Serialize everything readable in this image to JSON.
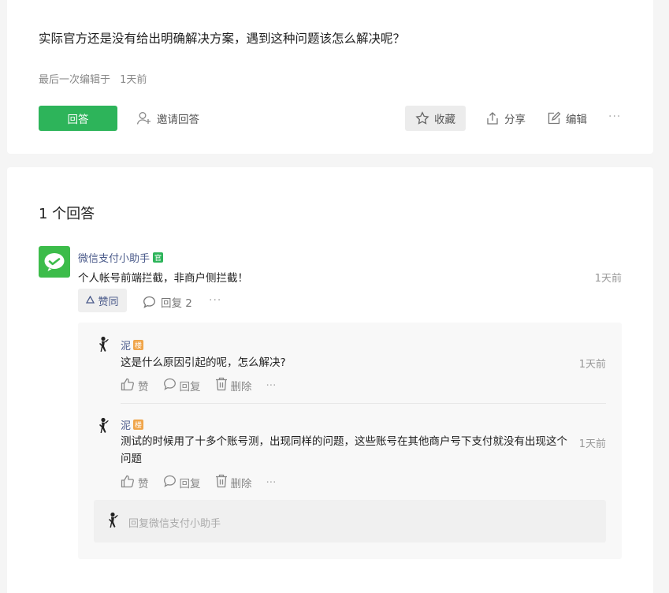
{
  "question": {
    "text": "实际官方还是没有给出明确解决方案，遇到这种问题该怎么解决呢？",
    "meta_label": "最后一次编辑于",
    "meta_time": "1天前",
    "actions": {
      "answer": "回答",
      "invite": "邀请回答",
      "favorite": "收藏",
      "share": "分享",
      "edit": "编辑",
      "more": "···"
    }
  },
  "answers": {
    "count_label": "1 个回答",
    "items": [
      {
        "author": "微信支付小助手",
        "badge": "官",
        "text": "个人帐号前端拦截，非商户侧拦截！",
        "time": "1天前",
        "like_label": "赞同",
        "reply_label": "回复 2",
        "more": "···",
        "comments": [
          {
            "author": "泥",
            "badge": "楼",
            "text": "这是什么原因引起的呢，怎么解决?",
            "time": "1天前",
            "actions": {
              "like": "赞",
              "reply": "回复",
              "delete": "删除",
              "more": "···"
            }
          },
          {
            "author": "泥",
            "badge": "楼",
            "text": "测试的时候用了十多个账号测，出现同样的问题，这些账号在其他商户号下支付就没有出现这个问题",
            "time": "1天前",
            "actions": {
              "like": "赞",
              "reply": "回复",
              "delete": "删除",
              "more": "···"
            }
          }
        ],
        "reply_placeholder": "回复微信支付小助手"
      }
    ]
  },
  "colors": {
    "brand_green": "#2db45a",
    "link_blue": "#4a5a8a",
    "floor_badge": "#f0a54a",
    "wechat_green": "#3cbc4a"
  }
}
